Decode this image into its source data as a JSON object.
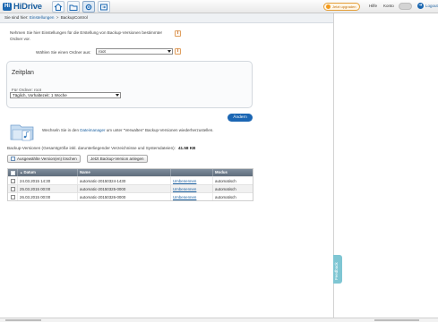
{
  "app": {
    "name": "HiDrive",
    "logo_mark": "Hi"
  },
  "topbar": {
    "nav_icons": [
      "home-icon",
      "folder-icon",
      "settings-icon",
      "share-icon"
    ],
    "upgrade_label": "Jetzt upgraden",
    "help_label": "Hilfe",
    "account_label": "Konto",
    "logout_label": "Logout"
  },
  "breadcrumb": {
    "prefix": "Sie sind hier:",
    "items": [
      "Einstellungen",
      "BackupControl"
    ],
    "separator": ">"
  },
  "intro": {
    "text": "Nehmen Sie hier Einstellungen für die Erstellung von Backup-Versionen bestimmter Ordner vor."
  },
  "folder_select": {
    "label": "Wählen Sie einen Ordner aus:",
    "value": "root"
  },
  "zeitplan": {
    "title": "Zeitplan",
    "subtitle": "Für Ordner: root",
    "schedule_value": "Täglich, Vorhaltezeit: 1 Woche"
  },
  "change_button": "Ändern",
  "dateimanager": {
    "text_before": "Wechseln Sie in den",
    "link": "Dateimanager",
    "text_after": "um unter \"Verwalten\" Backup-Versionen wiederherzustellen."
  },
  "stats": {
    "label": "Backup-Versionen (Gesamtgröße inkl. darunterliegender Verzeichnisse und Systemdateien):",
    "value": "41.58 KB"
  },
  "actions": {
    "delete_label": "Ausgewählte Version(en) löschen",
    "create_label": "Jetzt Backup-Version anlegen"
  },
  "table": {
    "headers": {
      "date": "Datum",
      "name": "Name",
      "rename": "",
      "mode": "Modus"
    },
    "rows": [
      {
        "date": "24.03.2015 14:30",
        "name": "automatic-20150324-1430",
        "action": "Umbenennen",
        "mode": "automatisch"
      },
      {
        "date": "25.03.2015 00:00",
        "name": "automatic-20150325-0000",
        "action": "Umbenennen",
        "mode": "automatisch"
      },
      {
        "date": "26.03.2015 00:00",
        "name": "automatic-20150326-0000",
        "action": "Umbenennen",
        "mode": "automatisch"
      }
    ]
  },
  "feedback_label": "Feedback",
  "colors": {
    "brand": "#1a66b0",
    "primary_button": "#1b66b3",
    "table_header": "#6b7988",
    "feedback": "#7fc6d3"
  }
}
